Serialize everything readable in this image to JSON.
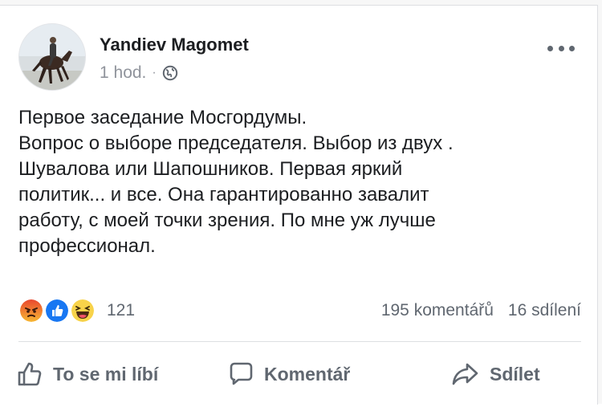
{
  "post": {
    "author": "Yandiev Magomet",
    "time": "1 hod.",
    "separator": "·",
    "privacy_icon": "globe-icon",
    "more_icon": "more-options-icon",
    "avatar_icon": "horse-rider-avatar",
    "lines": [
      "Первое заседание Мосгордумы.",
      "Вопрос о выборе председателя. Выбор из двух .",
      "Шувалова или Шапошников. Первая яркий",
      "политик... и все. Она гарантированно завалит",
      "работу, с моей точки зрения. По мне уж лучше",
      "профессионал."
    ]
  },
  "stats": {
    "reaction_icons": [
      "angry-reaction-icon",
      "like-reaction-icon",
      "haha-reaction-icon"
    ],
    "reaction_count": "121",
    "comments": "195 komentářů",
    "shares": "16 sdílení"
  },
  "actions": {
    "like_label": "To se mi líbí",
    "comment_label": "Komentář",
    "share_label": "Sdílet"
  },
  "colors": {
    "text": "#1c1e21",
    "secondary": "#606770",
    "meta": "#90949c",
    "like_blue": "#1877f2",
    "angry_top": "#f0673e",
    "haha_yellow": "#f8d34a",
    "divider": "#dddfe2"
  }
}
